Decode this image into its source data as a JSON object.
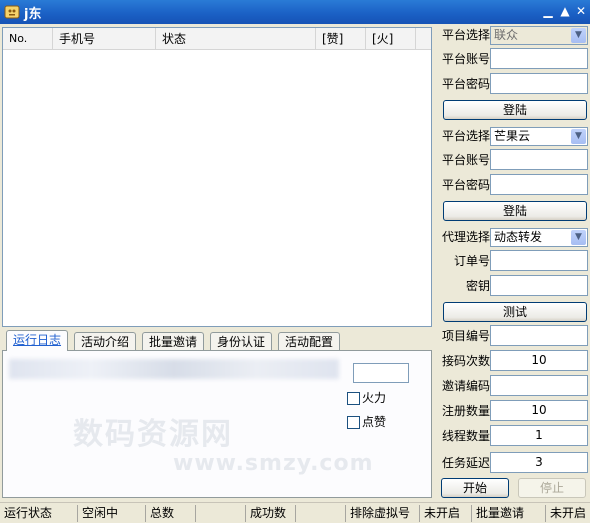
{
  "window": {
    "title": "j东"
  },
  "list": {
    "columns": [
      "No.",
      "手机号",
      "状态",
      "[赞]",
      "[火]"
    ]
  },
  "tabs": [
    "运行日志",
    "活动介绍",
    "批量邀请",
    "身份认证",
    "活动配置"
  ],
  "log_panel": {
    "checkbox_fire": "火力",
    "checkbox_like": "点赞",
    "watermark": "数码资源网",
    "watermark_url": "www.smzy.com"
  },
  "platform1": {
    "select_label": "平台选择",
    "select_value": "联众",
    "account_label": "平台账号",
    "account_value": "",
    "password_label": "平台密码",
    "password_value": "",
    "login_label": "登陆"
  },
  "platform2": {
    "select_label": "平台选择",
    "select_value": "芒果云",
    "account_label": "平台账号",
    "account_value": "",
    "password_label": "平台密码",
    "password_value": "",
    "login_label": "登陆"
  },
  "proxy": {
    "select_label": "代理选择",
    "select_value": "动态转发",
    "order_label": "订单号",
    "order_value": "",
    "key_label": "密钥",
    "key_value": "",
    "test_label": "测试"
  },
  "settings": {
    "project_label": "项目编号",
    "project_value": "",
    "code_times_label": "接码次数",
    "code_times_value": "10",
    "invite_code_label": "邀请编码",
    "invite_code_value": "",
    "register_count_label": "注册数量",
    "register_count_value": "10",
    "thread_count_label": "线程数量",
    "thread_count_value": "1",
    "task_delay_label": "任务延迟",
    "task_delay_value": "3",
    "start_label": "开始",
    "stop_label": "停止"
  },
  "statusbar": [
    "运行状态",
    "空闲中",
    "总数",
    "",
    "成功数",
    "",
    "排除虚拟号",
    "未开启",
    "批量邀请",
    "未开启"
  ]
}
